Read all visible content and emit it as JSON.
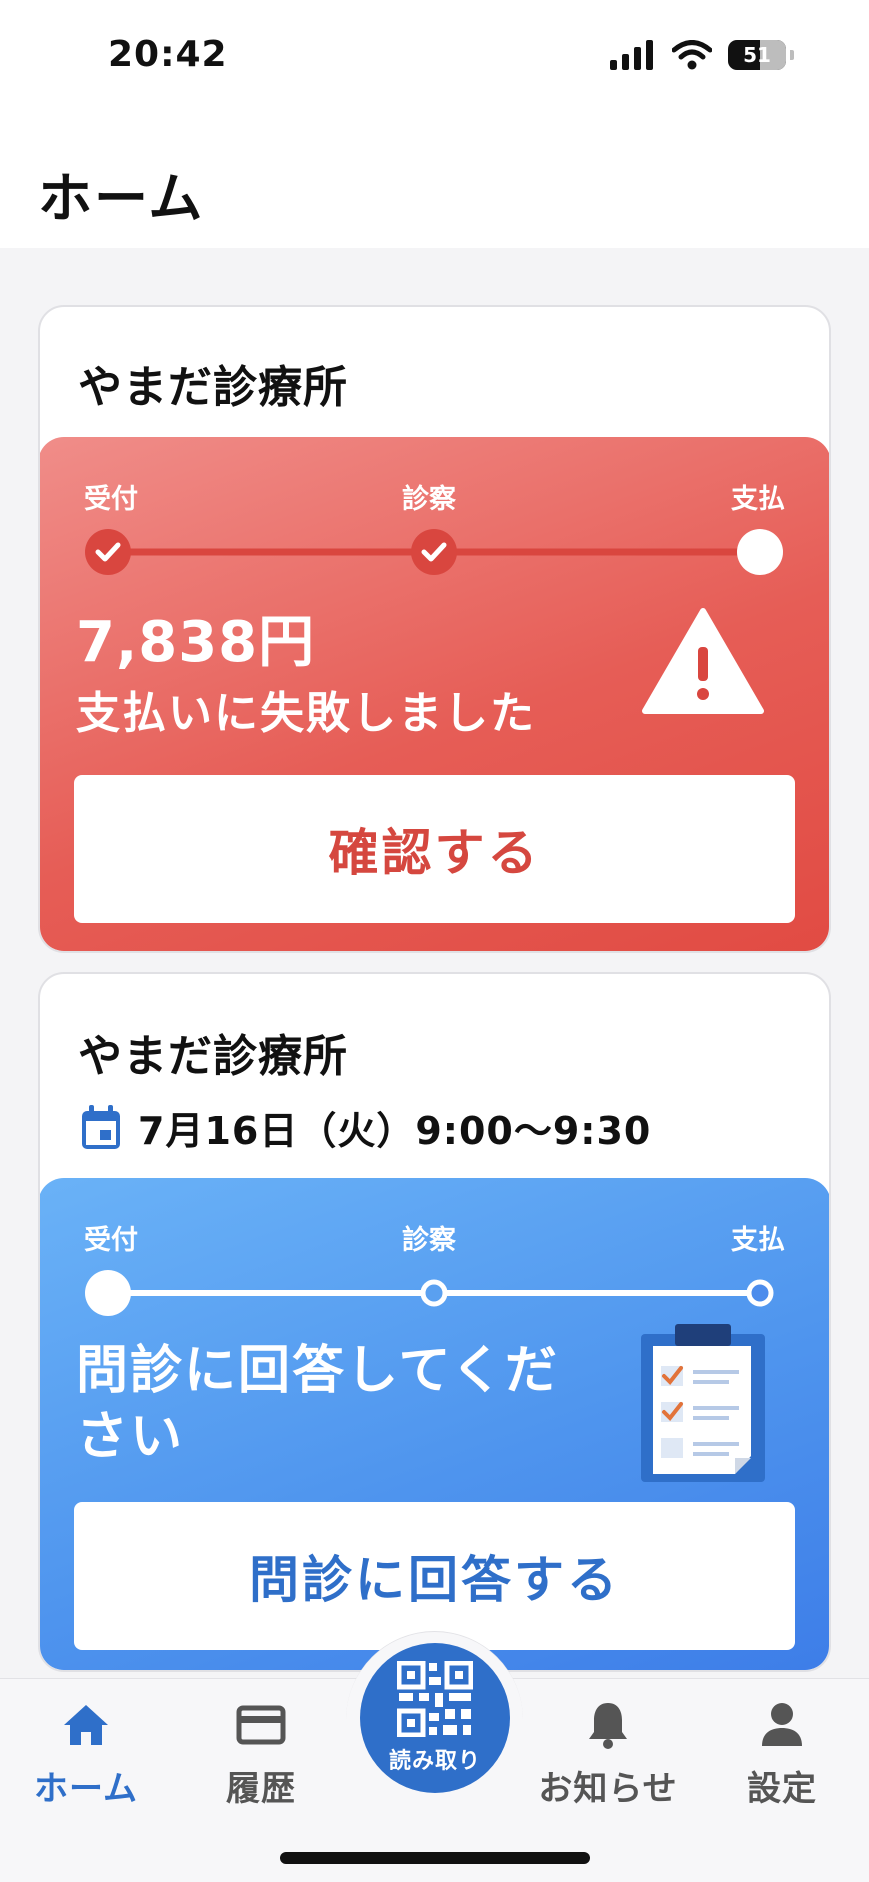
{
  "status_bar": {
    "time": "20:42",
    "battery": "51"
  },
  "header": {
    "title": "ホーム"
  },
  "steps": {
    "reception": "受付",
    "consultation": "診察",
    "payment": "支払"
  },
  "card_payment": {
    "clinic_name": "やまだ診療所",
    "amount": "7,838円",
    "message": "支払いに失敗しました",
    "button_label": "確認する",
    "icon": "warning-icon",
    "color": "#e14b43"
  },
  "card_questionnaire": {
    "clinic_name": "やまだ診療所",
    "date": "7月16日（火）9:00〜9:30",
    "message": "問診に回答してください",
    "button_label": "問診に回答する",
    "icon": "clipboard-icon",
    "color": "#3d7de8"
  },
  "tab_bar": {
    "items": [
      {
        "label": "ホーム",
        "icon": "home-icon",
        "active": true
      },
      {
        "label": "履歴",
        "icon": "card-icon",
        "active": false
      },
      {
        "label": "お知らせ",
        "icon": "bell-icon",
        "active": false
      },
      {
        "label": "設定",
        "icon": "person-icon",
        "active": false
      }
    ],
    "scan_label": "読み取り",
    "accent": "#2f6fc9"
  }
}
